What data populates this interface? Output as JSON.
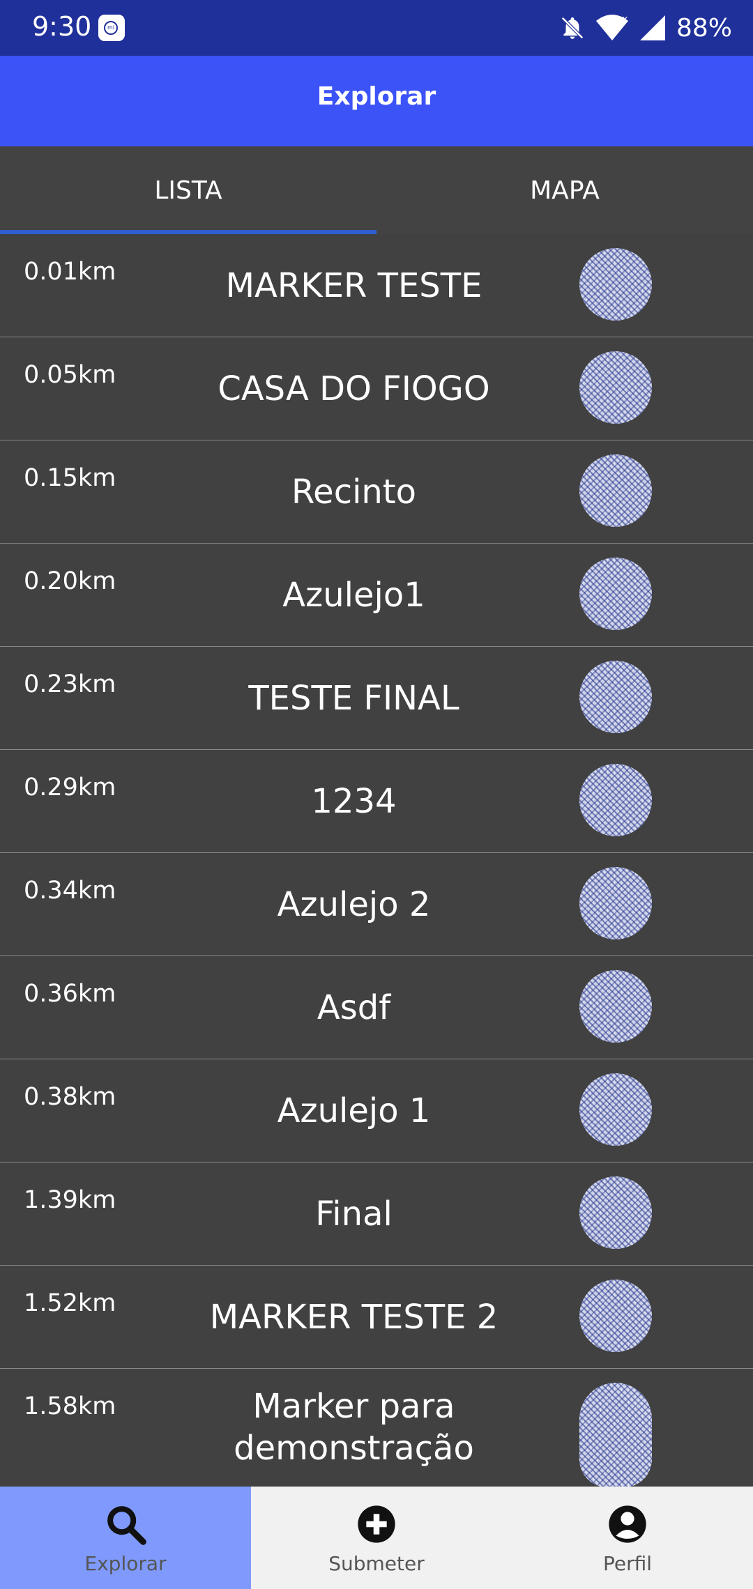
{
  "status_bar": {
    "time": "9:30",
    "battery": "88%"
  },
  "app_bar": {
    "title": "Explorar"
  },
  "tabs": [
    {
      "label": "LISTA"
    },
    {
      "label": "MAPA"
    }
  ],
  "list": [
    {
      "distance": "0.01km",
      "name": "MARKER TESTE"
    },
    {
      "distance": "0.05km",
      "name": "CASA DO FIOGO"
    },
    {
      "distance": "0.15km",
      "name": "Recinto"
    },
    {
      "distance": "0.20km",
      "name": "Azulejo1"
    },
    {
      "distance": "0.23km",
      "name": "TESTE FINAL"
    },
    {
      "distance": "0.29km",
      "name": "1234"
    },
    {
      "distance": "0.34km",
      "name": "Azulejo 2"
    },
    {
      "distance": "0.36km",
      "name": "Asdf"
    },
    {
      "distance": "0.38km",
      "name": "Azulejo 1"
    },
    {
      "distance": "1.39km",
      "name": "Final"
    },
    {
      "distance": "1.52km",
      "name": "MARKER TESTE 2"
    },
    {
      "distance": "1.58km",
      "name": "Marker para demonstração"
    }
  ],
  "bottom_nav": [
    {
      "label": "Explorar",
      "icon": "search-icon"
    },
    {
      "label": "Submeter",
      "icon": "add-circle-icon"
    },
    {
      "label": "Perfil",
      "icon": "account-circle-icon"
    }
  ],
  "colors": {
    "status_bar": "#20309a",
    "app_bar": "#3c53f8",
    "tab_indicator": "#2f5fcf",
    "nav_active": "#7f9afc",
    "list_bg": "#414141"
  }
}
